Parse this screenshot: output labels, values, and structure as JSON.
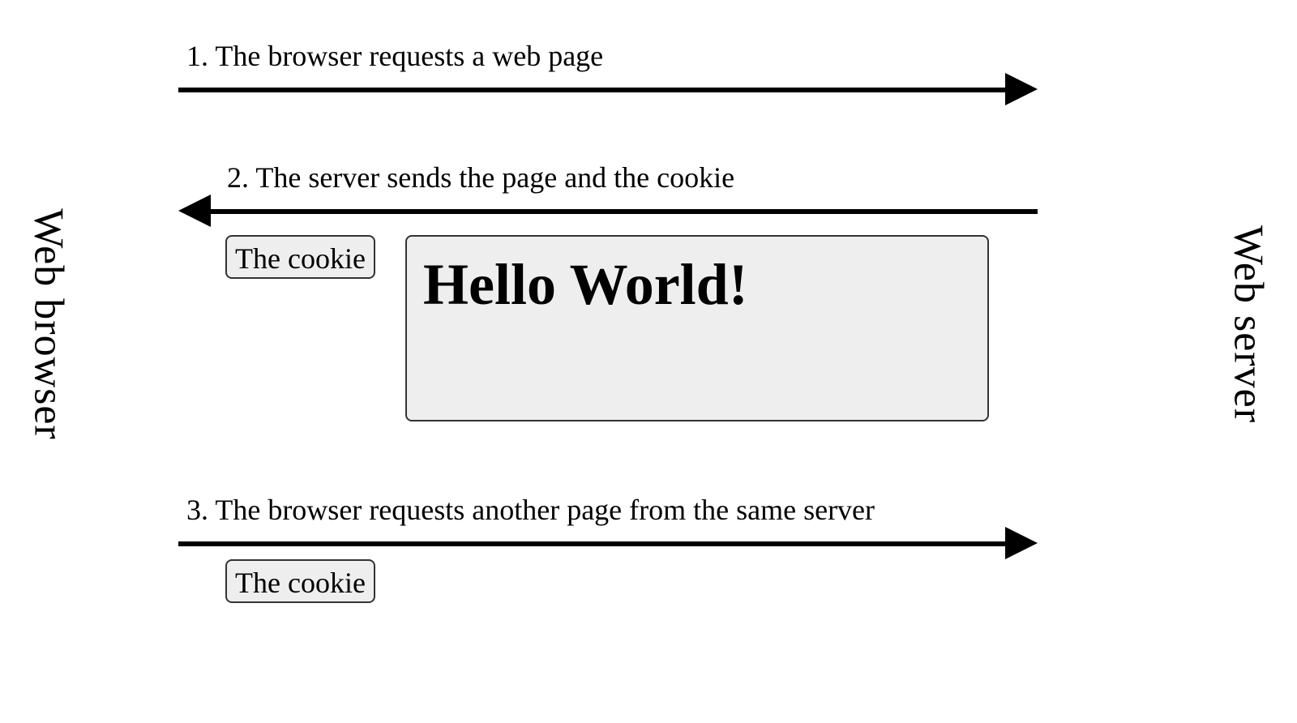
{
  "actors": {
    "browser_label": "Web browser",
    "server_label": "Web server"
  },
  "steps": {
    "s1": {
      "label": "1. The browser requests a web page"
    },
    "s2": {
      "label": "2. The server sends the page and the cookie",
      "cookie_label": "The cookie",
      "page_headline": "Hello World!"
    },
    "s3": {
      "label": "3. The browser requests another page from the same server",
      "cookie_label": "The cookie"
    }
  }
}
